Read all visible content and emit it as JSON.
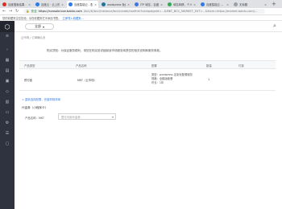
{
  "browser": {
    "tabs": [
      {
        "title": "百度搜索结果 - 阿里云 ...",
        "favicon_color": "#d93025",
        "active": false
      },
      {
        "title": "百度云 · 云上的事 ...",
        "favicon_color": "#2d7be6",
        "active": false
      },
      {
        "title": "百度智能云 - 配置确认 ...",
        "favicon_color": "#2d7be6",
        "active": true
      },
      {
        "title": "wordpress 免费网站 ...",
        "favicon_color": "#21759b",
        "active": false
      },
      {
        "title": "ITP 域名 - 百度搜索 ...",
        "favicon_color": "#3b78e7",
        "active": false
      },
      {
        "title": "域名转移、个人中心 ...",
        "favicon_color": "#34a853",
        "active": false
      },
      {
        "title": "百度智能云 ...",
        "favicon_color": "#2d7be6",
        "active": false
      },
      {
        "title": "无标题",
        "favicon_color": "#9aa0a6",
        "active": false
      }
    ],
    "url_secure": "安全",
    "url_host": "https://console.bce.baidu.com",
    "url_path": "/bcc/#/bcc/instance/bcc/create/confirm?campaignId=...&MKT_BCC_MARKET_EXT=...&from=https://market.baidu.com/...",
    "bookmark_text": "您的收藏夹空空如也，请在收藏夹栏中添加书签。",
    "bookmark_link": "立即导入收藏夹..."
  },
  "header": {
    "region_label": "全部"
  },
  "breadcrumb": "云市场  /  订单确认页",
  "notice": "购买须知：为保证服务顺利，请您在购买前详细阅读市场服务商提供的相关说明和服务条款。",
  "table": {
    "headers": [
      "产品类型",
      "产品名称",
      "配置",
      "数量",
      "付费"
    ],
    "rows": [
      {
        "type": "预付费",
        "name": "MKT（云市场）",
        "config": [
          "类型：wordpress 定制化配置服务",
          "规格：全模版套餐",
          "时长：1年"
        ],
        "qty": "1",
        "price": ""
      }
    ]
  },
  "back_link": "< 重新选择配置，完善购物清单",
  "section_title": "代金券（小程序卡）",
  "coupon": {
    "label": "产品名称：MKT",
    "placeholder": "暂无可用代金券"
  }
}
